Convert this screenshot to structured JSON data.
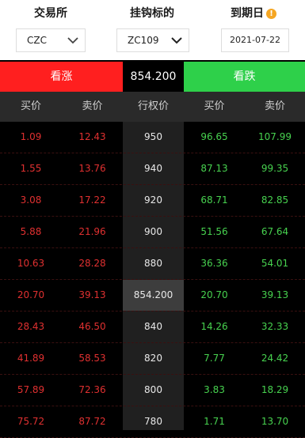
{
  "header": {
    "exchange_label": "交易所",
    "underlying_label": "挂钩标的",
    "expiry_label": "到期日",
    "info_icon": "!"
  },
  "selectors": {
    "exchange": "CZC",
    "underlying": "ZC109",
    "expiry_date": "2021-07-22"
  },
  "banner": {
    "call_label": "看涨",
    "underlying_price": "854.200",
    "put_label": "看跌"
  },
  "columns": {
    "call_bid": "买价",
    "call_ask": "卖价",
    "strike": "行权价",
    "put_bid": "买价",
    "put_ask": "卖价"
  },
  "rows": [
    {
      "call_bid": "1.09",
      "call_ask": "12.43",
      "strike": "950",
      "put_bid": "96.65",
      "put_ask": "107.99"
    },
    {
      "call_bid": "1.55",
      "call_ask": "13.76",
      "strike": "940",
      "put_bid": "87.13",
      "put_ask": "99.35"
    },
    {
      "call_bid": "3.08",
      "call_ask": "17.22",
      "strike": "920",
      "put_bid": "68.71",
      "put_ask": "82.85"
    },
    {
      "call_bid": "5.88",
      "call_ask": "21.96",
      "strike": "900",
      "put_bid": "51.56",
      "put_ask": "67.64"
    },
    {
      "call_bid": "10.63",
      "call_ask": "28.28",
      "strike": "880",
      "put_bid": "36.36",
      "put_ask": "54.01"
    },
    {
      "call_bid": "20.70",
      "call_ask": "39.13",
      "strike": "854.200",
      "put_bid": "20.70",
      "put_ask": "39.13"
    },
    {
      "call_bid": "28.43",
      "call_ask": "46.50",
      "strike": "840",
      "put_bid": "14.26",
      "put_ask": "32.33"
    },
    {
      "call_bid": "41.89",
      "call_ask": "58.53",
      "strike": "820",
      "put_bid": "7.77",
      "put_ask": "24.42"
    },
    {
      "call_bid": "57.89",
      "call_ask": "72.36",
      "strike": "800",
      "put_bid": "3.83",
      "put_ask": "18.29"
    },
    {
      "call_bid": "75.72",
      "call_ask": "87.72",
      "strike": "780",
      "put_bid": "1.71",
      "put_ask": "13.70"
    }
  ],
  "colors": {
    "call": "#ff1f1f",
    "put": "#2ed04a",
    "bid_ask_up": "#e03030",
    "bid_ask_down": "#47d24f",
    "info_icon": "#f5a623"
  }
}
